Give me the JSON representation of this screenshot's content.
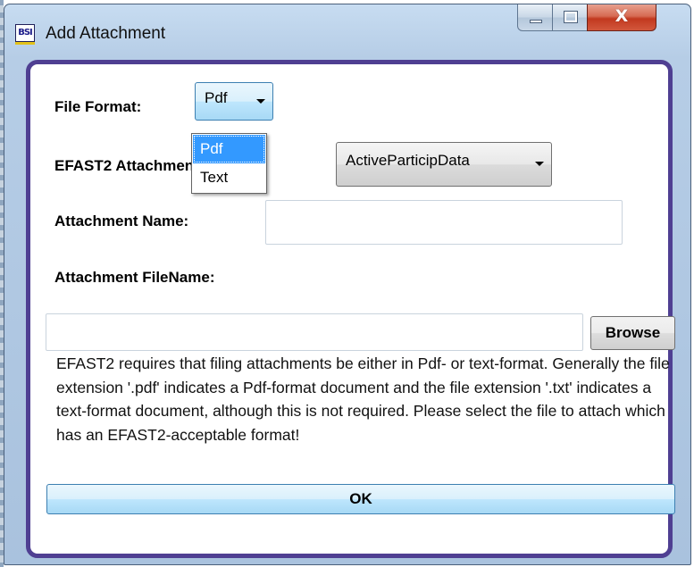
{
  "window": {
    "title": "Add Attachment",
    "icon": "app-logo-icon",
    "icon_text": "BSI",
    "close_glyph": "X"
  },
  "form": {
    "file_format_label": "File Format:",
    "file_format_value": "Pdf",
    "attachment_type_label": "EFAST2 Attachment Type:",
    "attachment_type_value": "ActiveParticipData",
    "attachment_name_label": "Attachment Name:",
    "attachment_name_value": "",
    "attachment_filename_label": "Attachment FileName:",
    "attachment_filename_value": "",
    "browse_label": "Browse",
    "description": "EFAST2 requires that filing attachments be either in Pdf- or text-format. Generally the file extension '.pdf' indicates a Pdf-format document and the file extension '.txt' indicates a text-format document, although this is not required. Please select the file to attach which has an EFAST2-acceptable format!",
    "ok_label": "OK"
  },
  "dropdown": {
    "options": [
      "Pdf",
      "Text"
    ],
    "selected": "Pdf"
  },
  "colors": {
    "frame_accent": "#4f3f92",
    "selection": "#3399ff",
    "button_focus": "#3c7fb1"
  }
}
